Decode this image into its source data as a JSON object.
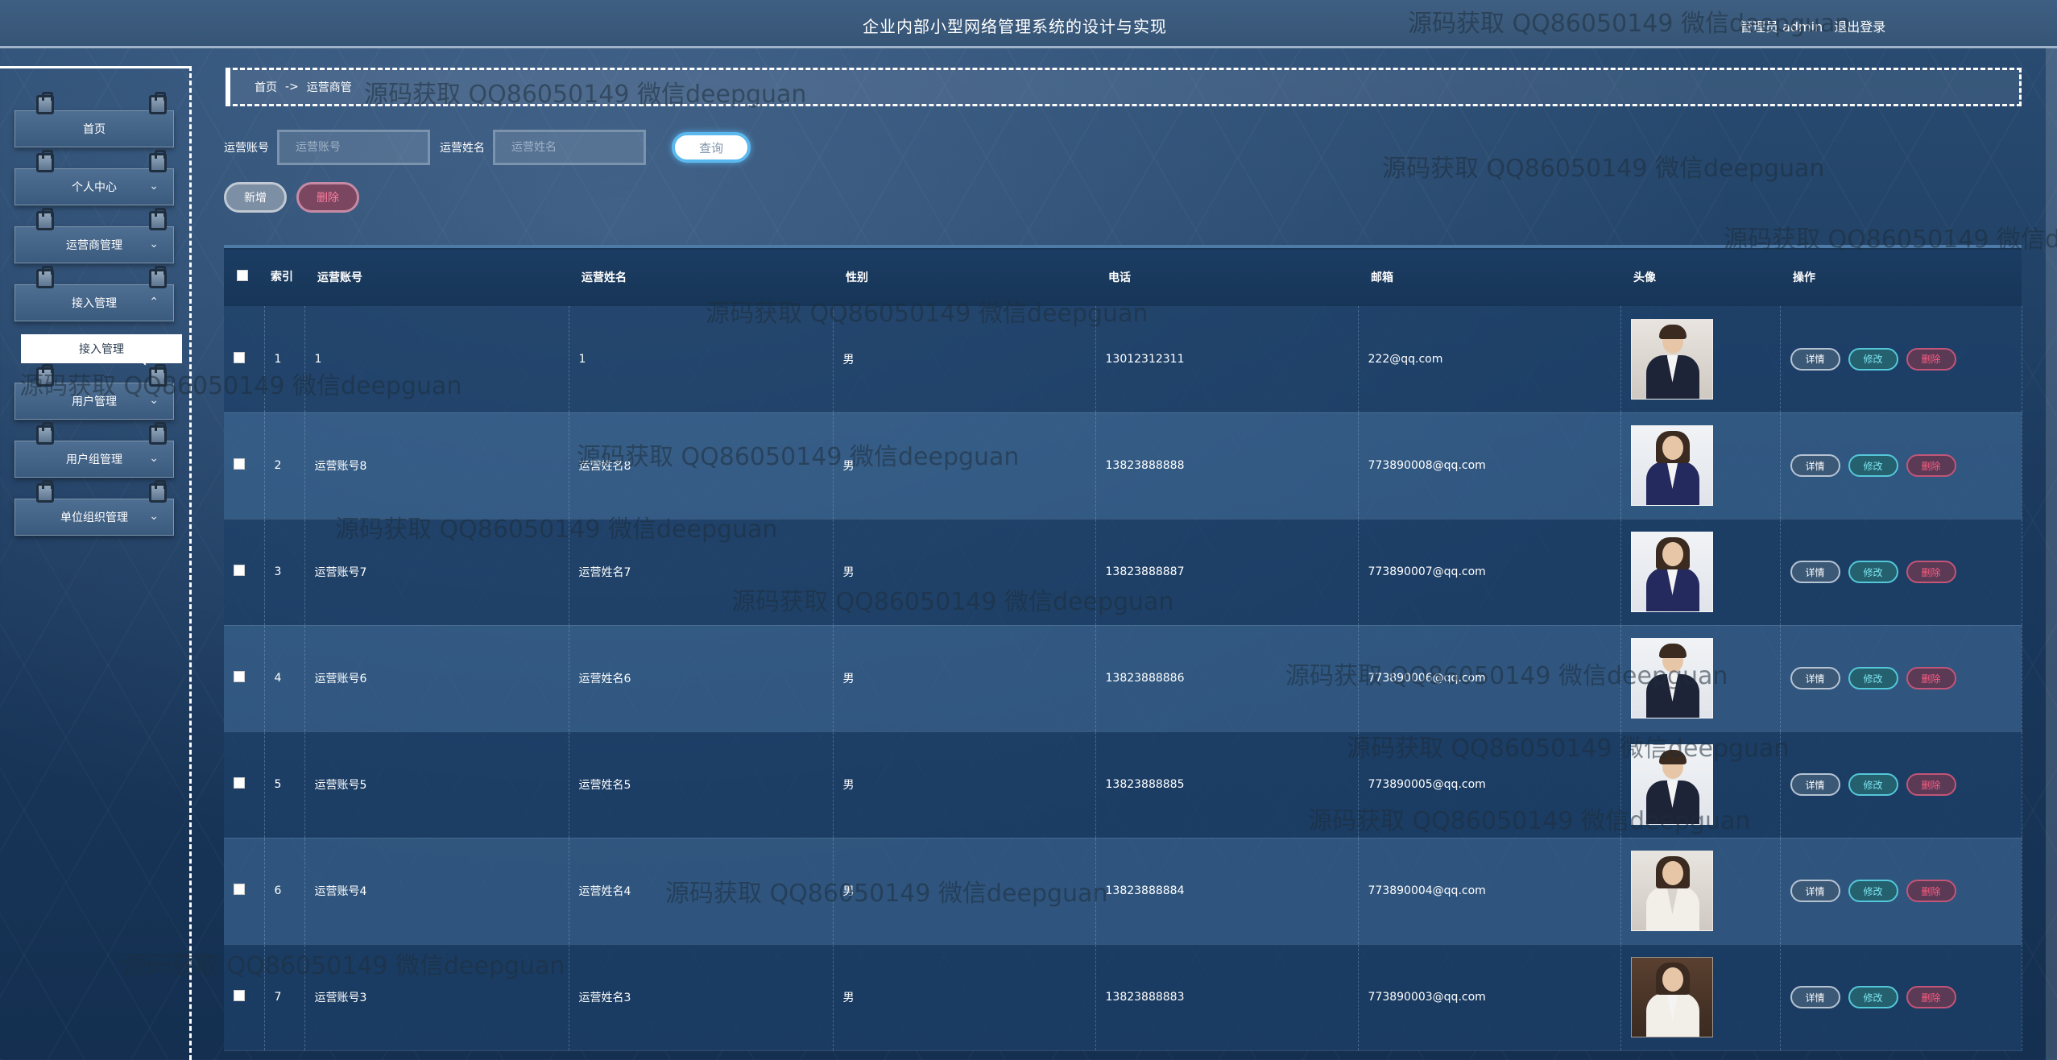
{
  "header": {
    "title": "企业内部小型网络管理系统的设计与实现",
    "user_label": "管理员 admin",
    "logout_label": "退出登录"
  },
  "sidebar": {
    "items": [
      {
        "label": "首页",
        "chevron": ""
      },
      {
        "label": "个人中心",
        "chevron": "⌄"
      },
      {
        "label": "运营商管理",
        "chevron": "⌄"
      },
      {
        "label": "接入管理",
        "chevron": "⌃"
      },
      {
        "label": "用户管理",
        "chevron": "⌄"
      },
      {
        "label": "用户组管理",
        "chevron": "⌄"
      },
      {
        "label": "单位组织管理",
        "chevron": "⌄"
      }
    ],
    "active_sub": "接入管理"
  },
  "breadcrumb": {
    "home": "首页",
    "separator": "->",
    "current": "运营商管"
  },
  "search": {
    "account_label": "运营账号",
    "account_placeholder": "运营账号",
    "name_label": "运营姓名",
    "name_placeholder": "运营姓名",
    "query_label": "查询"
  },
  "actions": {
    "add_label": "新增",
    "delete_label": "删除"
  },
  "table": {
    "headers": {
      "index": "索引",
      "account": "运营账号",
      "name": "运营姓名",
      "gender": "性别",
      "phone": "电话",
      "email": "邮箱",
      "avatar": "头像",
      "ops": "操作"
    },
    "op_labels": {
      "detail": "详情",
      "edit": "修改",
      "delete": "删除"
    },
    "rows": [
      {
        "index": "1",
        "account": "1",
        "name": "1",
        "gender": "男",
        "phone": "13012312311",
        "email": "222@qq.com",
        "avatar": "man-suit-avatar"
      },
      {
        "index": "2",
        "account": "运营账号8",
        "name": "运营姓名8",
        "gender": "男",
        "phone": "13823888888",
        "email": "773890008@qq.com",
        "avatar": "woman-suit-avatar"
      },
      {
        "index": "3",
        "account": "运营账号7",
        "name": "运营姓名7",
        "gender": "男",
        "phone": "13823888887",
        "email": "773890007@qq.com",
        "avatar": "woman-suit-avatar"
      },
      {
        "index": "4",
        "account": "运营账号6",
        "name": "运营姓名6",
        "gender": "男",
        "phone": "13823888886",
        "email": "773890006@qq.com",
        "avatar": "man-suit-avatar"
      },
      {
        "index": "5",
        "account": "运营账号5",
        "name": "运营姓名5",
        "gender": "男",
        "phone": "13823888885",
        "email": "773890005@qq.com",
        "avatar": "man-suit-avatar"
      },
      {
        "index": "6",
        "account": "运营账号4",
        "name": "运营姓名4",
        "gender": "男",
        "phone": "13823888884",
        "email": "773890004@qq.com",
        "avatar": "woman-white-avatar"
      },
      {
        "index": "7",
        "account": "运营账号3",
        "name": "运营姓名3",
        "gender": "男",
        "phone": "13823888883",
        "email": "773890003@qq.com",
        "avatar": "woman-white-avatar"
      }
    ]
  },
  "watermark": "源码获取 QQ86050149 微信deepguan"
}
